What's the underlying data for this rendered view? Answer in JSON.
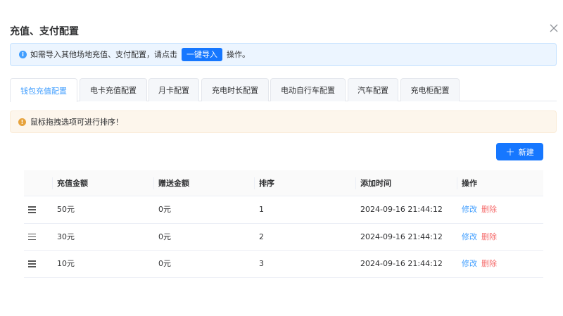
{
  "dialog": {
    "title": "充值、支付配置"
  },
  "info_alert": {
    "text_before": "如需导入其他场地充值、支付配置，请点击",
    "button_label": "一键导入",
    "text_after": "操作。"
  },
  "tabs": [
    {
      "label": "钱包充值配置",
      "active": true
    },
    {
      "label": "电卡充值配置",
      "active": false
    },
    {
      "label": "月卡配置",
      "active": false
    },
    {
      "label": "充电时长配置",
      "active": false
    },
    {
      "label": "电动自行车配置",
      "active": false
    },
    {
      "label": "汽车配置",
      "active": false
    },
    {
      "label": "充电柜配置",
      "active": false
    }
  ],
  "warn_alert": {
    "text": "鼠标拖拽选项可进行排序！"
  },
  "toolbar": {
    "new_label": "新建"
  },
  "table": {
    "headers": [
      "充值金额",
      "赠送金额",
      "排序",
      "添加时间",
      "操作"
    ],
    "rows": [
      {
        "amount": "50元",
        "bonus": "0元",
        "order": "1",
        "time": "2024-09-16 21:44:12"
      },
      {
        "amount": "30元",
        "bonus": "0元",
        "order": "2",
        "time": "2024-09-16 21:44:12"
      },
      {
        "amount": "10元",
        "bonus": "0元",
        "order": "3",
        "time": "2024-09-16 21:44:12"
      }
    ],
    "edit_label": "修改",
    "delete_label": "删除"
  },
  "colors": {
    "primary": "#1677ff",
    "link": "#409eff",
    "danger": "#f56c6c",
    "warning": "#e6a23c"
  }
}
